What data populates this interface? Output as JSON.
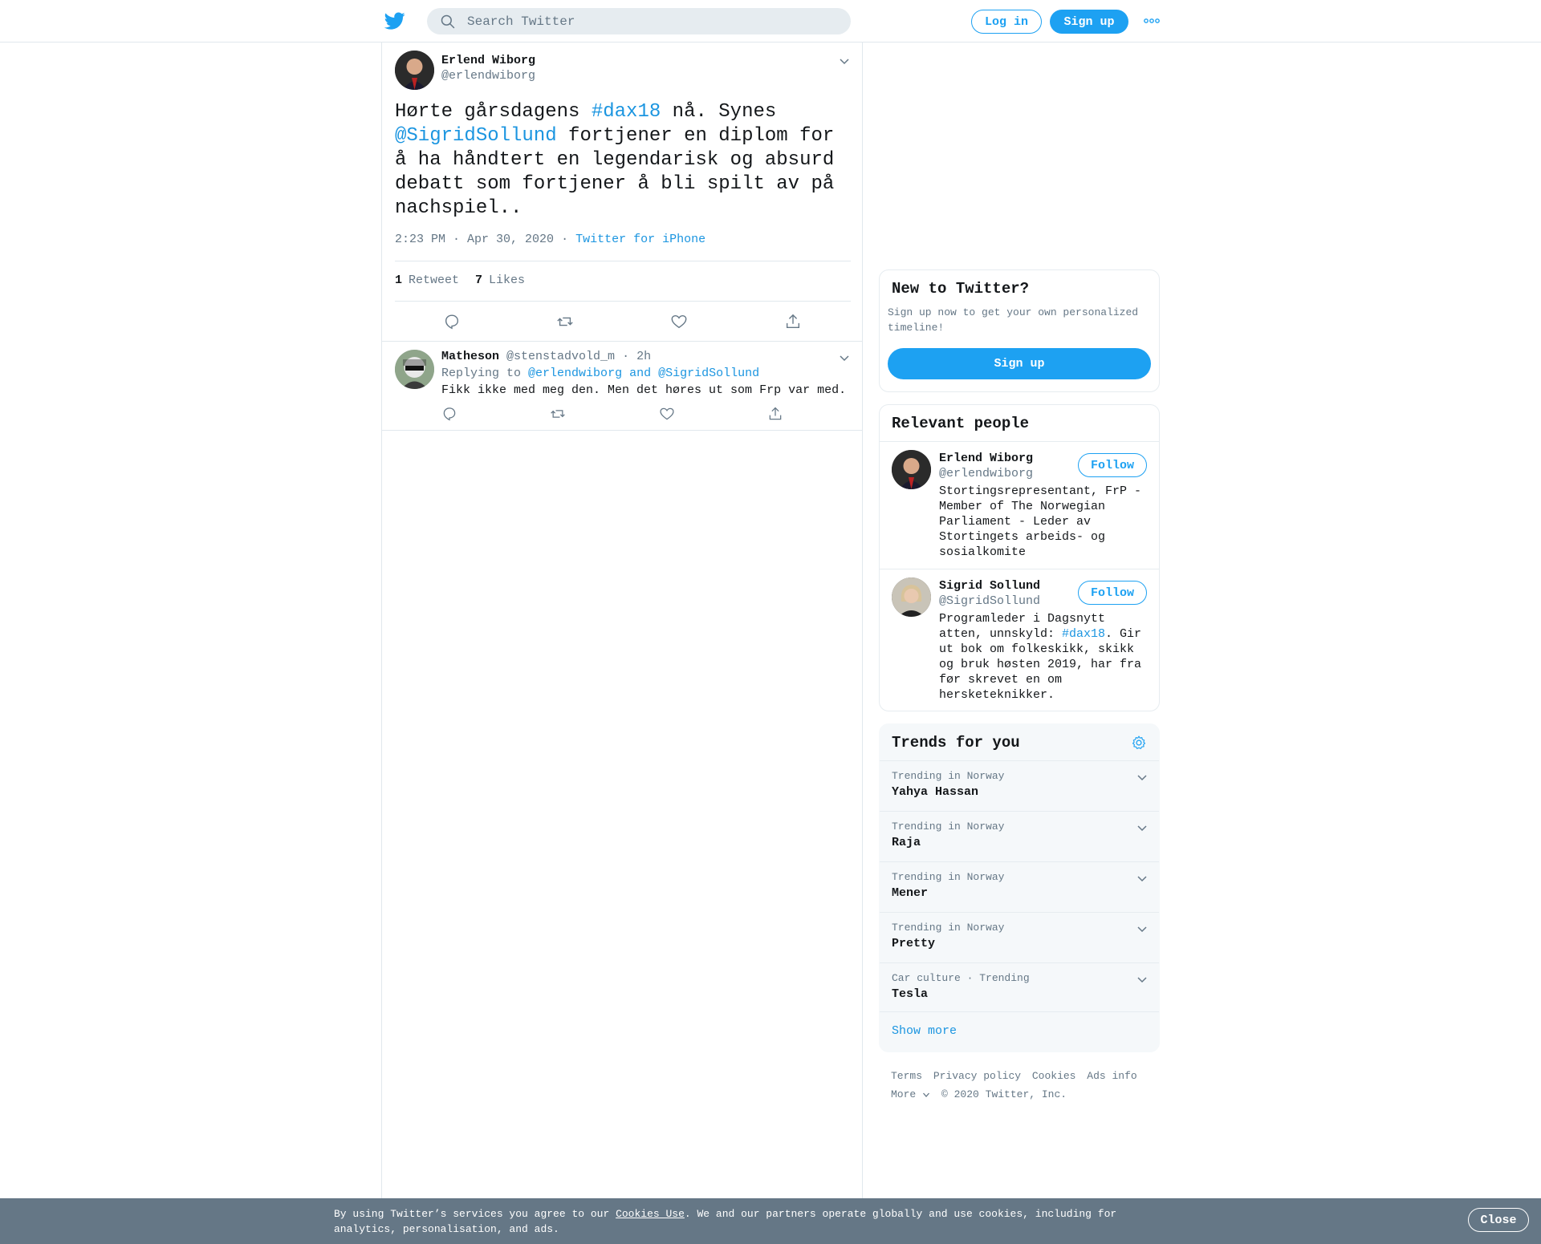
{
  "header": {
    "search_placeholder": "Search Twitter",
    "login_label": "Log in",
    "signup_label": "Sign up",
    "brand_color": "#1da1f2"
  },
  "tweet": {
    "author_name": "Erlend Wiborg",
    "author_handle": "@erlendwiborg",
    "text_part1": "Hørte gårsdagens ",
    "hashtag": "#dax18",
    "text_part2": " nå. Synes ",
    "mention": "@SigridSollund",
    "text_part3": " fortjener en diplom for å ha håndtert en legendarisk og absurd debatt som fortjener å bli spilt av på nachspiel..",
    "timestamp": "2:23 PM · Apr 30, 2020",
    "separator": "·",
    "source": "Twitter for iPhone",
    "retweet_count": "1",
    "retweet_label": "Retweet",
    "like_count": "7",
    "like_label": "Likes"
  },
  "reply": {
    "author_name": "Matheson",
    "author_handle": "@stenstadvold_m",
    "time": "· 2h",
    "replying_prefix": "Replying to",
    "replying_to": "@erlendwiborg and @SigridSollund",
    "text": "Fikk ikke med meg den. Men det høres ut som Frp var med."
  },
  "new_to_twitter": {
    "title": "New to Twitter?",
    "subtitle": "Sign up now to get your own personalized timeline!",
    "button": "Sign up"
  },
  "relevant_people": {
    "title": "Relevant people",
    "people": [
      {
        "name": "Erlend Wiborg",
        "handle": "@erlendwiborg",
        "follow": "Follow",
        "bio": "Stortingsrepresentant, FrP - Member of The Norwegian Parliament - Leder av Stortingets arbeids- og sosialkomite"
      },
      {
        "name": "Sigrid Sollund",
        "handle": "@SigridSollund",
        "follow": "Follow",
        "bio_part1": "Programleder i Dagsnytt atten, unnskyld: ",
        "bio_hashtag": "#dax18",
        "bio_part2": ". Gir ut bok om folkeskikk, skikk og bruk høsten 2019, har fra før skrevet en om hersketeknikker."
      }
    ]
  },
  "trends": {
    "title": "Trends for you",
    "items": [
      {
        "context": "Trending in Norway",
        "name": "Yahya Hassan"
      },
      {
        "context": "Trending in Norway",
        "name": "Raja"
      },
      {
        "context": "Trending in Norway",
        "name": "Mener"
      },
      {
        "context": "Trending in Norway",
        "name": "Pretty"
      },
      {
        "context": "Car culture · Trending",
        "name": "Tesla"
      }
    ],
    "show_more": "Show more"
  },
  "footer": {
    "links": [
      "Terms",
      "Privacy policy",
      "Cookies",
      "Ads info"
    ],
    "more": "More",
    "copyright": "© 2020 Twitter, Inc."
  },
  "cookie_bar": {
    "text_prefix": "By using Twitter’s services you agree to our ",
    "link": "Cookies Use",
    "text_suffix": ". We and our partners operate globally and use cookies, including for analytics, personalisation, and ads.",
    "close": "Close"
  }
}
